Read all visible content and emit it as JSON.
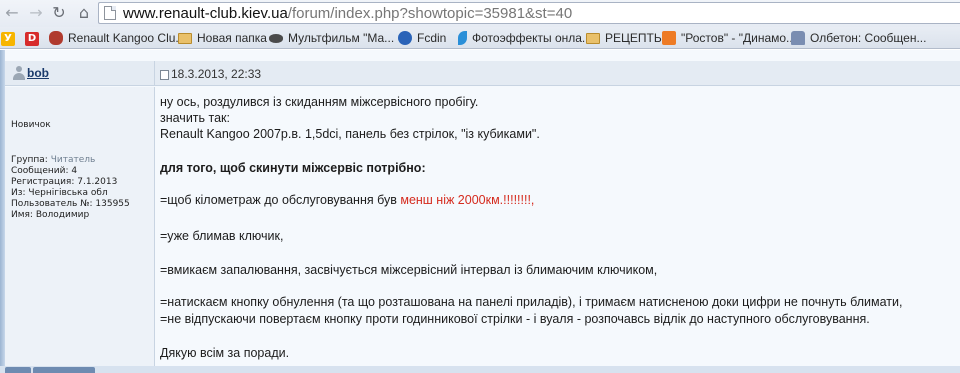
{
  "browser": {
    "url_host": "www.renault-club.kiev.ua",
    "url_path": "/forum/index.php?showtopic=35981&st=40",
    "bookmarks": [
      {
        "label": "Renault Kangoo Clu...",
        "icon": "renault-icon"
      },
      {
        "label": "Новая папка",
        "icon": "folder-icon"
      },
      {
        "label": "Мультфильм \"Ма...",
        "icon": "eye-icon"
      },
      {
        "label": "Fcdin",
        "icon": "dynamo-icon"
      },
      {
        "label": "Фотоэффекты онла...",
        "icon": "leaf-icon"
      },
      {
        "label": "РЕЦЕПТЫ",
        "icon": "folder-icon"
      },
      {
        "label": "\"Ростов\" - \"Динамо...",
        "icon": "blogger-icon"
      },
      {
        "label": "Олбетон: Сообщен...",
        "icon": "house-icon"
      }
    ]
  },
  "post": {
    "author": "bob",
    "date": "18.3.2013, 22:33",
    "rank": "Новичок",
    "info": {
      "group_label": "Группа:",
      "group_value": "Читатель",
      "messages": "Сообщений: 4",
      "registered": "Регистрация: 7.1.2013",
      "from": "Из: Чернігівська обл",
      "user_number": "Пользователь №: 135955",
      "name": "Имя: Володимир"
    },
    "body": {
      "line1": "ну ось, роздулився із скиданням міжсервісного пробігу.",
      "line2": "значить так:",
      "line3": "Renault Kangoo 2007р.в. 1,5dci, панель без стрілок, \"із кубиками\".",
      "heading": "для того, щоб скинути міжсервіс потрібно:",
      "step1_prefix": "=щоб кілометраж до обслуговування був ",
      "step1_highlight": "менш ніж 2000км.!!!!!!!!,",
      "step2": "=уже блимав ключик,",
      "step3": "=вмикаєм запалювання, засвічується міжсервісний інтервал із блимаючим ключиком,",
      "step4": "=натискаєм кнопку обнулення (та що розташована на панелі приладів), і тримаєм натисненою доки цифри не почнуть блимати,",
      "step5": "=не відпускаючи повертаєм кнопку проти годинникової стрілки - і вуаля - розпочавсь відлік до наступного обслуговування.",
      "thanks": "Дякую всім за поради."
    }
  },
  "colors": {
    "accent_red": "#d52b1e",
    "author_link": "#1a3a6b",
    "header_bg": "#e4ebf3"
  }
}
